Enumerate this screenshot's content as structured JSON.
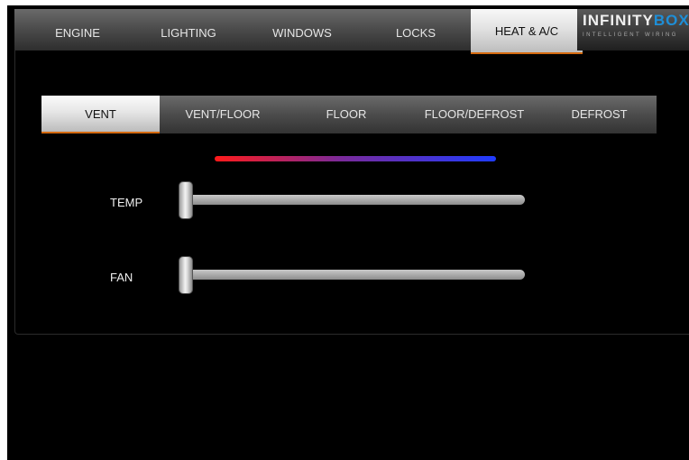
{
  "nav": {
    "tabs": [
      {
        "label": "ENGINE"
      },
      {
        "label": "LIGHTING"
      },
      {
        "label": "WINDOWS"
      },
      {
        "label": "LOCKS"
      },
      {
        "label": "HEAT & A/C"
      }
    ],
    "active_tab": "HEAT & A/C",
    "logo": {
      "main_a": "INFINITY",
      "main_b": "BOX",
      "sub": "INTELLIGENT WIRING"
    }
  },
  "modes": {
    "items": [
      {
        "label": "VENT"
      },
      {
        "label": "VENT/FLOOR"
      },
      {
        "label": "FLOOR"
      },
      {
        "label": "FLOOR/DEFROST"
      },
      {
        "label": "DEFROST"
      }
    ],
    "active": "VENT"
  },
  "controls": {
    "temp": {
      "label": "TEMP",
      "value_fraction": 0.0
    },
    "fan": {
      "label": "FAN",
      "value_fraction": 0.0
    }
  },
  "colors": {
    "accent": "#d46a10",
    "hot": "#ff1a1a",
    "cold": "#1f3cff",
    "logo_blue": "#1e8fd8"
  }
}
